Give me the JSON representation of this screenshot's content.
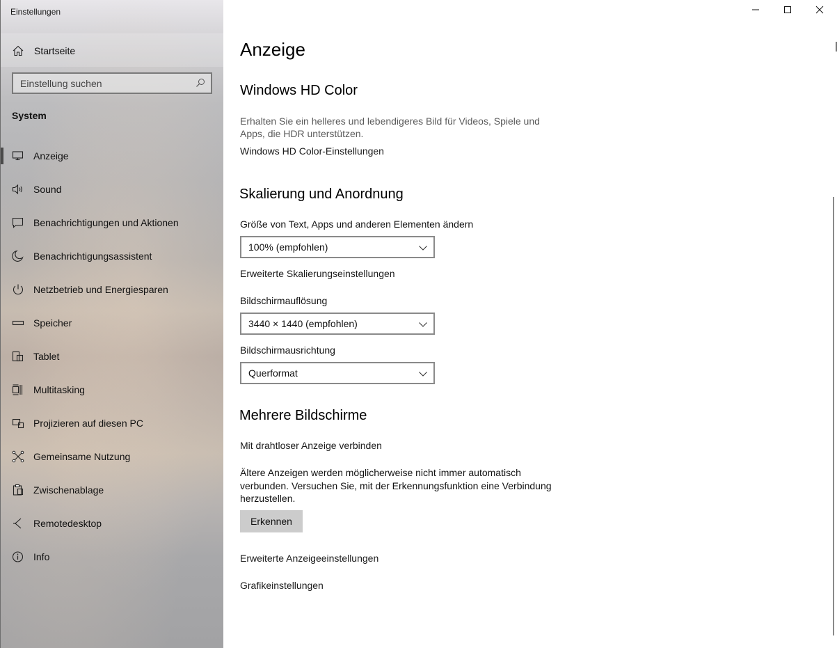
{
  "window": {
    "title": "Einstellungen"
  },
  "sidebar": {
    "home_label": "Startseite",
    "search_placeholder": "Einstellung suchen",
    "section": "System",
    "items": [
      {
        "label": "Anzeige",
        "icon": "monitor-icon",
        "active": true
      },
      {
        "label": "Sound",
        "icon": "speaker-icon"
      },
      {
        "label": "Benachrichtigungen und Aktionen",
        "icon": "notification-icon"
      },
      {
        "label": "Benachrichtigungsassistent",
        "icon": "moon-icon"
      },
      {
        "label": "Netzbetrieb und Energiesparen",
        "icon": "power-icon"
      },
      {
        "label": "Speicher",
        "icon": "storage-icon"
      },
      {
        "label": "Tablet",
        "icon": "tablet-icon"
      },
      {
        "label": "Multitasking",
        "icon": "multitasking-icon"
      },
      {
        "label": "Projizieren auf diesen PC",
        "icon": "project-icon"
      },
      {
        "label": "Gemeinsame Nutzung",
        "icon": "share-icon"
      },
      {
        "label": "Zwischenablage",
        "icon": "clipboard-icon"
      },
      {
        "label": "Remotedesktop",
        "icon": "remote-desktop-icon"
      },
      {
        "label": "Info",
        "icon": "info-icon"
      }
    ]
  },
  "main": {
    "title": "Anzeige",
    "hdr": {
      "heading": "Windows HD Color",
      "description": "Erhalten Sie ein helleres und lebendigeres Bild für Videos, Spiele und Apps, die HDR unterstützen.",
      "link": "Windows HD Color-Einstellungen"
    },
    "scaling": {
      "heading": "Skalierung und Anordnung",
      "size_label": "Größe von Text, Apps und anderen Elementen ändern",
      "size_value": "100% (empfohlen)",
      "advanced_link": "Erweiterte Skalierungseinstellungen",
      "resolution_label": "Bildschirmauflösung",
      "resolution_value": "3440 × 1440 (empfohlen)",
      "orientation_label": "Bildschirmausrichtung",
      "orientation_value": "Querformat"
    },
    "multi": {
      "heading": "Mehrere Bildschirme",
      "wireless_link": "Mit drahtloser Anzeige verbinden",
      "note": "Ältere Anzeigen werden möglicherweise nicht immer automatisch verbunden. Versuchen Sie, mit der Erkennungsfunktion eine Verbindung herzustellen.",
      "detect_button": "Erkennen",
      "advanced_display_link": "Erweiterte Anzeigeeinstellungen",
      "graphics_link": "Grafikeinstellungen"
    }
  },
  "window_controls": {
    "minimize": "minimize-icon",
    "maximize": "maximize-icon",
    "close": "close-icon"
  }
}
